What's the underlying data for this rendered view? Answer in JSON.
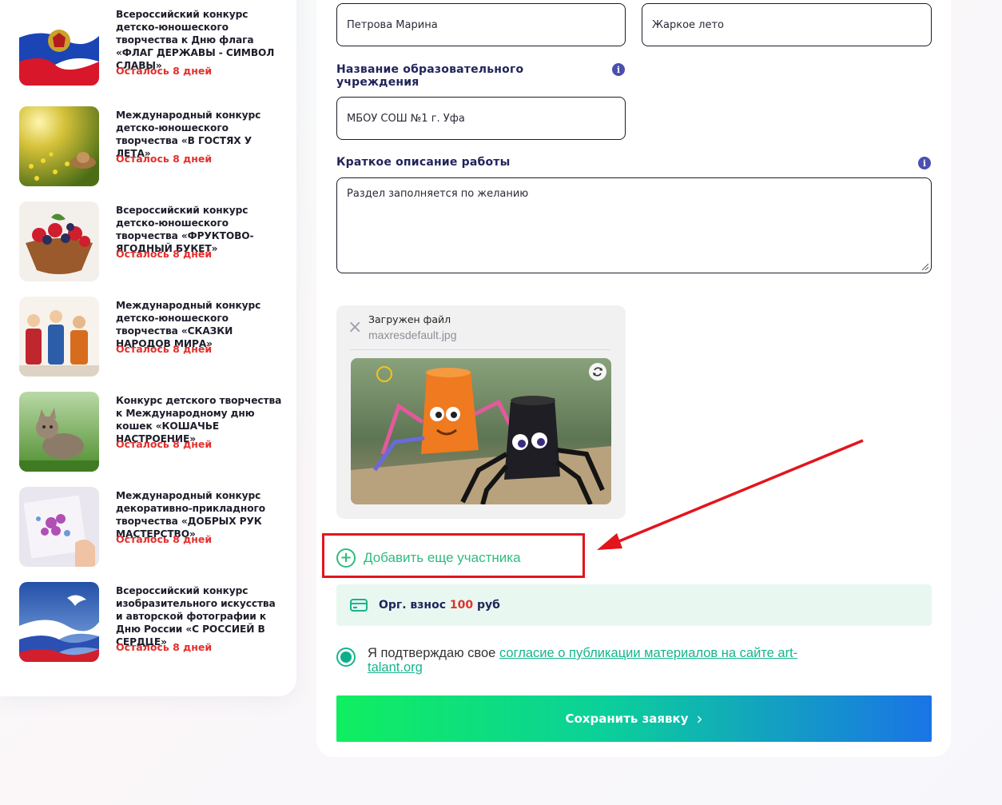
{
  "sidebar": {
    "contests": [
      {
        "title": "Всероссийский конкурс детско-юношеского творчества к Дню флага «ФЛАГ ДЕРЖАВЫ - СИМВОЛ СЛАВЫ»",
        "days": "Осталось 8 дней"
      },
      {
        "title": "Международный конкурс детско-юношеского творчества «В ГОСТЯХ У ЛЕТА»",
        "days": "Осталось 8 дней"
      },
      {
        "title": "Всероссийский конкурс детско-юношеского творчества «ФРУКТОВО-ЯГОДНЫЙ БУКЕТ»",
        "days": "Осталось 8 дней"
      },
      {
        "title": "Международный конкурс детско-юношеского творчества «СКАЗКИ НАРОДОВ МИРА»",
        "days": "Осталось 8 дней"
      },
      {
        "title": "Конкурс детского творчества к Международному дню кошек «КОШАЧЬЕ НАСТРОЕНИЕ»",
        "days": "Осталось 8 дней"
      },
      {
        "title": "Международный конкурс декоративно-прикладного творчества «ДОБРЫХ РУК МАСТЕРСТВО»",
        "days": "Осталось 8 дней"
      },
      {
        "title": "Всероссийский конкурс изобразительного искусства и авторской фотографии к Дню России «С РОССИЕЙ В СЕРДЦЕ»",
        "days": "Осталось 8 дней"
      }
    ]
  },
  "form": {
    "participant_name": "Петрова Марина",
    "work_title": "Жаркое лето",
    "institution_label": "Название образовательного учреждения",
    "institution_value": "МБОУ СОШ №1 г. Уфа",
    "description_label": "Краткое описание работы",
    "description_placeholder": "Раздел заполняется по желанию",
    "info_glyph": "i",
    "upload": {
      "label": "Загружен файл",
      "filename": "maxresdefault.jpg",
      "close_glyph": "×"
    },
    "add_participant": "Добавить еще участника",
    "plus_glyph": "+",
    "fee": {
      "label": "Орг. взнос",
      "amount": "100",
      "currency": "руб"
    },
    "consent": {
      "text": "Я подтверждаю свое",
      "link": "согласие о публикации материалов на сайте art-talant.org"
    },
    "save_button": "Сохранить заявку",
    "save_chevron": "›"
  },
  "colors": {
    "accent_green": "#2fbc7e",
    "price_red": "#e2302d",
    "annotation_red": "#e3141c",
    "label_navy": "#21245a"
  },
  "icons": [
    "info-icon",
    "close-icon",
    "rotate-icon",
    "plus-circle-icon",
    "wallet-icon",
    "radio-checked-icon",
    "chevron-right-icon"
  ]
}
